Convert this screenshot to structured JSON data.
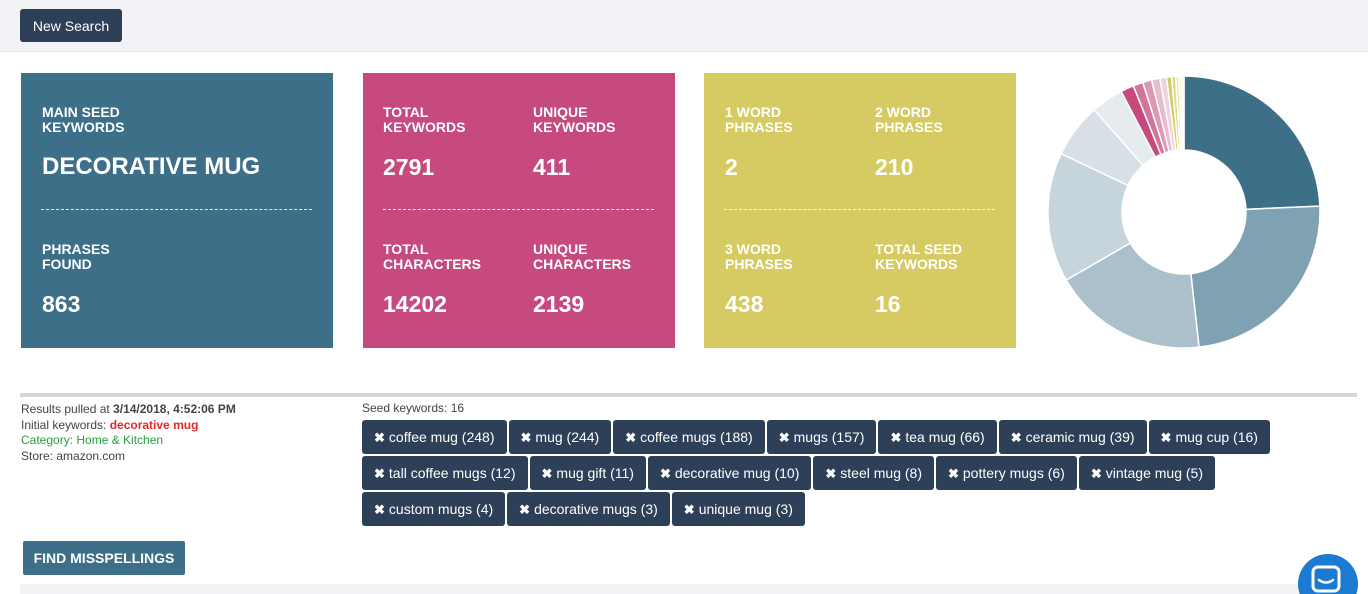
{
  "toolbar": {
    "new_search_label": "New Search"
  },
  "seed_card": {
    "main_seed_label": "MAIN SEED KEYWORDS",
    "main_seed_value": "DECORATIVE MUG",
    "phrases_found_label": "PHRASES FOUND",
    "phrases_found_value": "863"
  },
  "keyword_card": {
    "total_keywords_label": "TOTAL KEYWORDS",
    "total_keywords_value": "2791",
    "unique_keywords_label": "UNIQUE KEYWORDS",
    "unique_keywords_value": "411",
    "total_characters_label": "TOTAL CHARACTERS",
    "total_characters_value": "14202",
    "unique_characters_label": "UNIQUE CHARACTERS",
    "unique_characters_value": "2139"
  },
  "phrase_card": {
    "one_word_label": "1 WORD PHRASES",
    "one_word_value": "2",
    "two_word_label": "2 WORD PHRASES",
    "two_word_value": "210",
    "three_word_label": "3 WORD PHRASES",
    "three_word_value": "438",
    "total_seed_label": "TOTAL SEED KEYWORDS",
    "total_seed_value": "16"
  },
  "donut": {
    "slices": [
      {
        "value": 248,
        "color": "#3d6f89"
      },
      {
        "value": 244,
        "color": "#7fa2b3"
      },
      {
        "value": 188,
        "color": "#abc0cb"
      },
      {
        "value": 157,
        "color": "#c6d4dc"
      },
      {
        "value": 66,
        "color": "#d7e0e6"
      },
      {
        "value": 39,
        "color": "#e6ebee"
      },
      {
        "value": 16,
        "color": "#c64a7d"
      },
      {
        "value": 12,
        "color": "#d2759b"
      },
      {
        "value": 11,
        "color": "#dd99b4"
      },
      {
        "value": 10,
        "color": "#e8bccd"
      },
      {
        "value": 8,
        "color": "#f0d3de"
      },
      {
        "value": 6,
        "color": "#d5cb62"
      },
      {
        "value": 5,
        "color": "#e1d98c"
      },
      {
        "value": 4,
        "color": "#ebe6b4"
      },
      {
        "value": 3,
        "color": "#f2eed3"
      },
      {
        "value": 3,
        "color": "#f7f5e6"
      }
    ]
  },
  "info": {
    "results_prefix": "Results pulled at ",
    "results_time": "3/14/2018, 4:52:06 PM",
    "initial_prefix": "Initial keywords: ",
    "initial_value": "decorative mug",
    "category": "Category: Home & Kitchen",
    "store": "Store: amazon.com"
  },
  "seed_keywords": {
    "title": "Seed keywords: 16",
    "chips": [
      "coffee mug (248)",
      "mug (244)",
      "coffee mugs (188)",
      "mugs (157)",
      "tea mug (66)",
      "ceramic mug (39)",
      "mug cup (16)",
      "tall coffee mugs (12)",
      "mug gift (11)",
      "decorative mug (10)",
      "steel mug (8)",
      "pottery mugs (6)",
      "vintage mug (5)",
      "custom mugs (4)",
      "decorative mugs (3)",
      "unique mug (3)"
    ]
  },
  "actions": {
    "find_misspellings_label": "FIND MISSPELLINGS"
  }
}
